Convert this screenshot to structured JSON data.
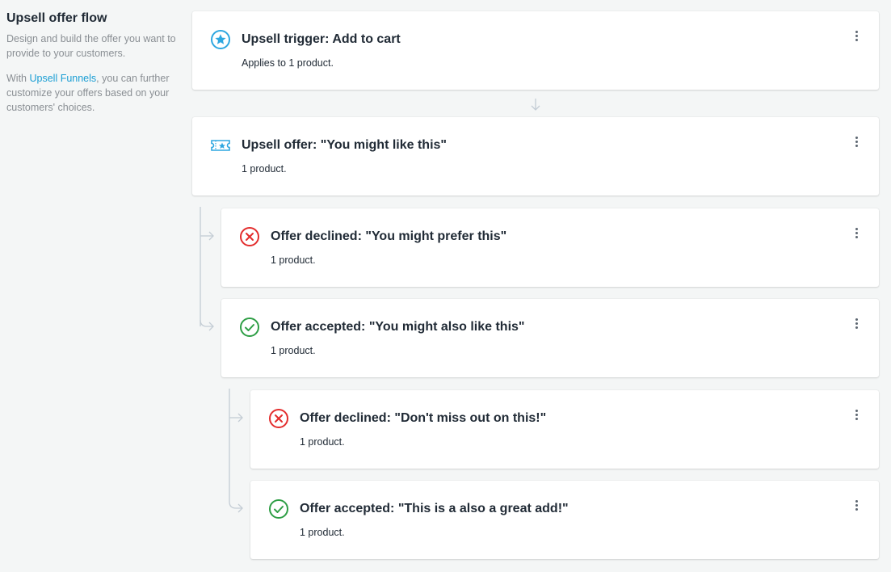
{
  "sidebar": {
    "title": "Upsell offer flow",
    "description": "Design and build the offer you want to provide to your customers.",
    "note_prefix": "With ",
    "note_link": "Upsell Funnels",
    "note_suffix": ", you can further customize your offers based on your customers' choices."
  },
  "colors": {
    "accent": "#1a9ed4",
    "declined": "#e32c2c",
    "accepted": "#2e9e45",
    "trigger": "#2ea7e0"
  },
  "cards": [
    {
      "title": "Upsell trigger: Add to cart",
      "subtitle": "Applies to 1 product.",
      "icon": "star-circle-icon"
    },
    {
      "title": "Upsell offer: \"You might like this\"",
      "subtitle": "1 product.",
      "icon": "ticket-icon"
    },
    {
      "title": "Offer declined: \"You might prefer this\"",
      "subtitle": "1 product.",
      "icon": "declined-x-icon"
    },
    {
      "title": "Offer accepted: \"You might also like this\"",
      "subtitle": "1 product.",
      "icon": "accepted-check-icon"
    },
    {
      "title": "Offer declined: \"Don't miss out on this!\"",
      "subtitle": "1 product.",
      "icon": "declined-x-icon"
    },
    {
      "title": "Offer accepted: \"This is a also a great add!\"",
      "subtitle": "1 product.",
      "icon": "accepted-check-icon"
    }
  ]
}
